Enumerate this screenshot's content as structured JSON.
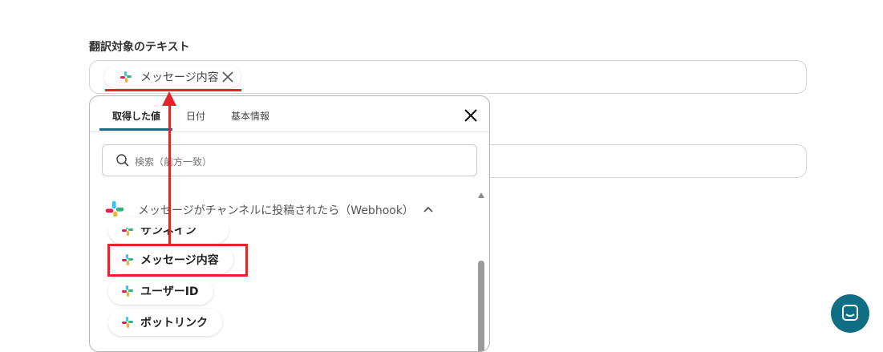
{
  "field": {
    "label": "翻訳対象のテキスト",
    "selected_tag": "メッセージ内容"
  },
  "popup": {
    "tabs": [
      "取得した値",
      "日付",
      "基本情報"
    ],
    "active_tab": "取得した値",
    "search": {
      "placeholder": "検索（前方一致）"
    },
    "group_title": "メッセージがチャンネルに投稿されたら（Webhook）",
    "items": [
      {
        "label": "サンネイン",
        "icon": "slack-icon"
      },
      {
        "label": "メッセージ内容",
        "icon": "slack-icon"
      },
      {
        "label": "ユーザーID",
        "icon": "slack-icon"
      },
      {
        "label": "ボットリンク",
        "icon": "slack-icon"
      }
    ]
  },
  "colors": {
    "accent": "#176a8a",
    "annotation_red": "#e8222a",
    "chat_button": "#0f6e84"
  },
  "icons": {
    "tag_remove": "close-icon",
    "popup_close": "close-icon",
    "search": "search-icon",
    "group_toggle": "chevron-up-icon",
    "chat": "chat-icon"
  }
}
